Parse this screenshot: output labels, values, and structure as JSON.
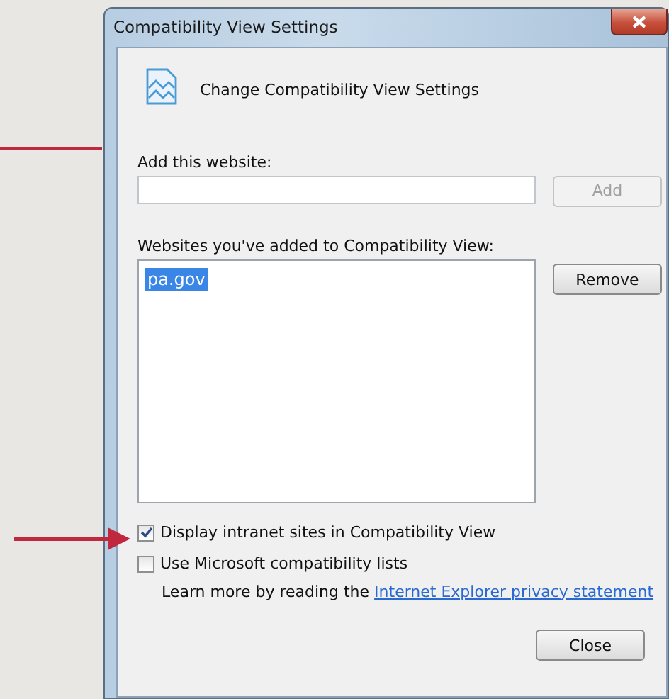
{
  "window": {
    "title": "Compatibility View Settings"
  },
  "header": {
    "text": "Change Compatibility View Settings"
  },
  "add_website": {
    "label": "Add this website:",
    "button": {
      "label": "Add",
      "disabled": true
    }
  },
  "websites": {
    "label": "Websites you've added to Compatibility View:",
    "items": [
      {
        "text": "pa.gov",
        "selected": true
      }
    ],
    "button": {
      "label": "Remove",
      "disabled": false
    }
  },
  "options": [
    {
      "label": "Display intranet sites in Compatibility View",
      "checked": true
    },
    {
      "label": "Use Microsoft compatibility lists",
      "checked": false
    }
  ],
  "learn_more": {
    "text": "Learn more by reading the",
    "link": "Internet Explorer privacy statement"
  },
  "buttons": [
    {
      "label": "Close"
    }
  ]
}
